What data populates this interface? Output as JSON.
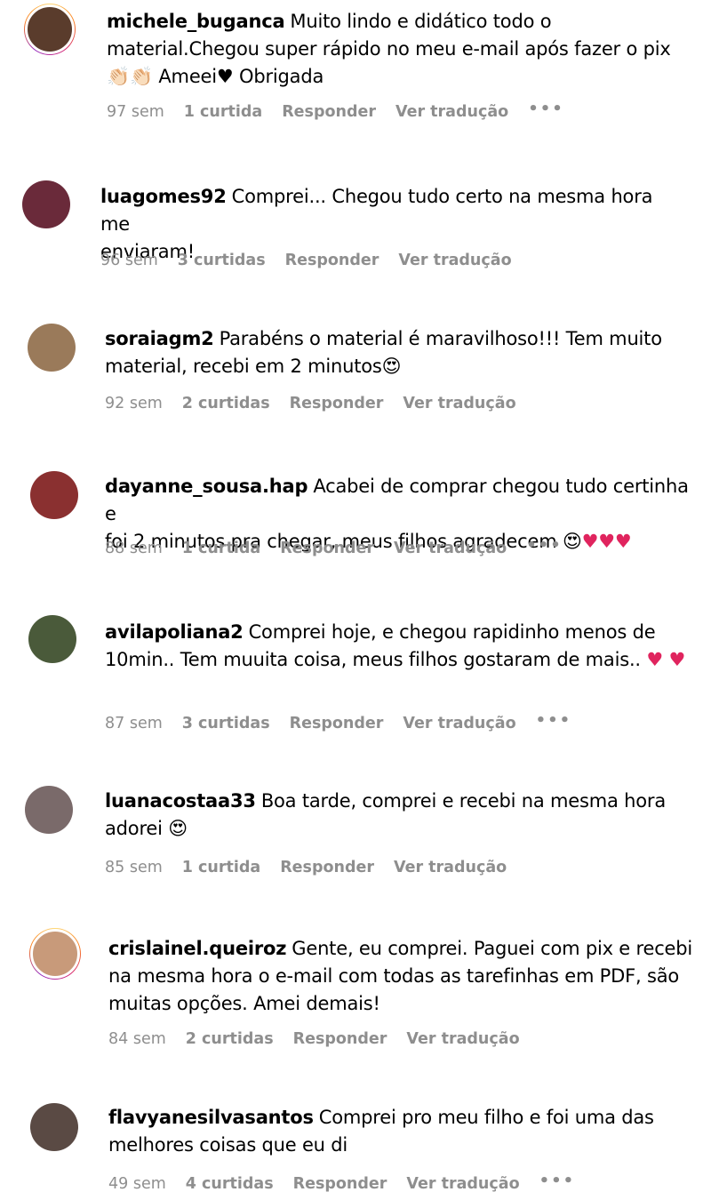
{
  "comments": [
    {
      "username": "michele_buganca",
      "text": "Muito lindo e didático todo o\nmaterial.Chegou super rápido no meu e-mail após fazer o pix\n",
      "tail": "Ameei",
      "tail2": "Obrigada",
      "time": "97 sem",
      "likes": "1 curtida",
      "reply": "Responder",
      "translate": "Ver tradução",
      "more": "•••",
      "avatar_color": "#5a3c2c",
      "story": true
    },
    {
      "username": "luagomes92",
      "text": "Comprei... Chegou tudo certo na mesma hora me\nenviaram!",
      "time": "96 sem",
      "likes": "3 curtidas",
      "reply": "Responder",
      "translate": "Ver tradução",
      "avatar_color": "#6a2a3a",
      "story": false
    },
    {
      "username": "soraiagm2",
      "text": "Parabéns o material é maravilhoso!!! Tem muito\nmaterial, recebi em 2 minutos",
      "time": "92 sem",
      "likes": "2 curtidas",
      "reply": "Responder",
      "translate": "Ver tradução",
      "avatar_color": "#9a7a5a",
      "story": false
    },
    {
      "username": "dayanne_sousa.hap",
      "text": "Acabei de comprar chegou tudo certinha e\nfoi 2 minutos pra chegar, meus filhos agradecem",
      "time": "88 sem",
      "likes": "1 curtida",
      "reply": "Responder",
      "translate": "Ver tradução",
      "more": "•••",
      "avatar_color": "#8a3030",
      "story": false
    },
    {
      "username": "avilapoliana2",
      "text": "Comprei hoje, e chegou rapidinho menos de\n10min.. Tem muuita coisa, meus filhos gostaram de mais..",
      "time": "87 sem",
      "likes": "3 curtidas",
      "reply": "Responder",
      "translate": "Ver tradução",
      "more": "•••",
      "avatar_color": "#4a5a3a",
      "story": false
    },
    {
      "username": "luanacostaa33",
      "text": "Boa tarde, comprei e recebi na mesma hora\nadorei",
      "time": "85 sem",
      "likes": "1 curtida",
      "reply": "Responder",
      "translate": "Ver tradução",
      "avatar_color": "#7a6a6a",
      "story": false
    },
    {
      "username": "crislainel.queiroz",
      "text": "Gente, eu comprei. Paguei com pix e recebi\nna mesma hora o e-mail com todas as tarefinhas em PDF, são\nmuitas opções. Amei demais!",
      "time": "84 sem",
      "likes": "2 curtidas",
      "reply": "Responder",
      "translate": "Ver tradução",
      "avatar_color": "#c89a7a",
      "story": true
    },
    {
      "username": "flavyanesilvasantos",
      "text": "Comprei pro meu filho e foi uma das\nmelhores coisas que eu di",
      "time": "49 sem",
      "likes": "4 curtidas",
      "reply": "Responder",
      "translate": "Ver tradução",
      "more": "•••",
      "avatar_color": "#5a4a44",
      "story": false
    }
  ],
  "colors": {
    "meta": "#8e8e8e",
    "heart": "#e0245e"
  }
}
